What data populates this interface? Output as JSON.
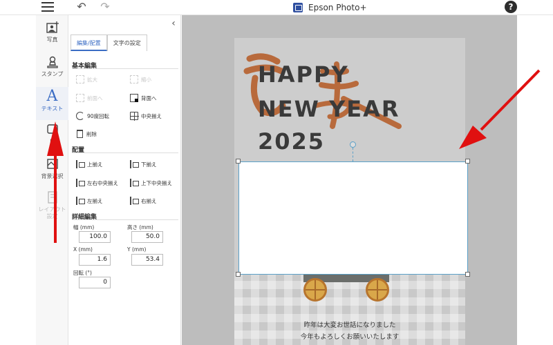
{
  "app": {
    "title": "Epson Photo+"
  },
  "toolbar": {
    "undo_icon": "undo-icon",
    "redo_icon": "redo-icon",
    "help_label": "?"
  },
  "rail": {
    "items": [
      {
        "label": "写真",
        "icon": "photo-icon",
        "state": "normal"
      },
      {
        "label": "スタンプ",
        "icon": "stamp-icon",
        "state": "normal"
      },
      {
        "label": "テキスト",
        "icon": "text-icon",
        "state": "active"
      },
      {
        "label": "日",
        "icon": "frame-icon",
        "state": "normal"
      },
      {
        "label": "背景選択",
        "icon": "background-icon",
        "state": "normal"
      },
      {
        "label": "レイアウト 設定",
        "icon": "layout-icon",
        "state": "disabled"
      }
    ]
  },
  "panel": {
    "tabs": [
      {
        "label": "編集/配置",
        "active": true
      },
      {
        "label": "文字の設定",
        "active": false
      }
    ],
    "basic_edit": {
      "title": "基本編集",
      "ops": [
        {
          "label": "拡大",
          "enabled": false
        },
        {
          "label": "縮小",
          "enabled": false
        },
        {
          "label": "前面へ",
          "enabled": false
        },
        {
          "label": "背面へ",
          "enabled": true
        },
        {
          "label": "90度回転",
          "enabled": true
        },
        {
          "label": "中央揃え",
          "enabled": true
        },
        {
          "label": "削除",
          "enabled": true
        }
      ]
    },
    "arrange": {
      "title": "配置",
      "ops": [
        {
          "label": "上揃え"
        },
        {
          "label": "下揃え"
        },
        {
          "label": "左右中央揃え"
        },
        {
          "label": "上下中央揃え"
        },
        {
          "label": "左揃え"
        },
        {
          "label": "右揃え"
        }
      ]
    },
    "detail": {
      "title": "詳細編集",
      "width_label": "幅 (mm)",
      "width": "100.0",
      "height_label": "高さ (mm)",
      "height": "50.0",
      "x_label": "X (mm)",
      "x": "1.6",
      "y_label": "Y (mm)",
      "y": "53.4",
      "rotation_label": "回転 (°)",
      "rotation": "0"
    }
  },
  "card": {
    "headline": [
      "HAPPY",
      "NEW YEAR",
      "2025"
    ],
    "greeting": [
      "昨年は大変お世話になりました",
      "今年もよろしくお願いいたします"
    ]
  },
  "colors": {
    "accent": "#3a6cc4",
    "arrow": "#e01010",
    "brush": "#b86a3c"
  }
}
